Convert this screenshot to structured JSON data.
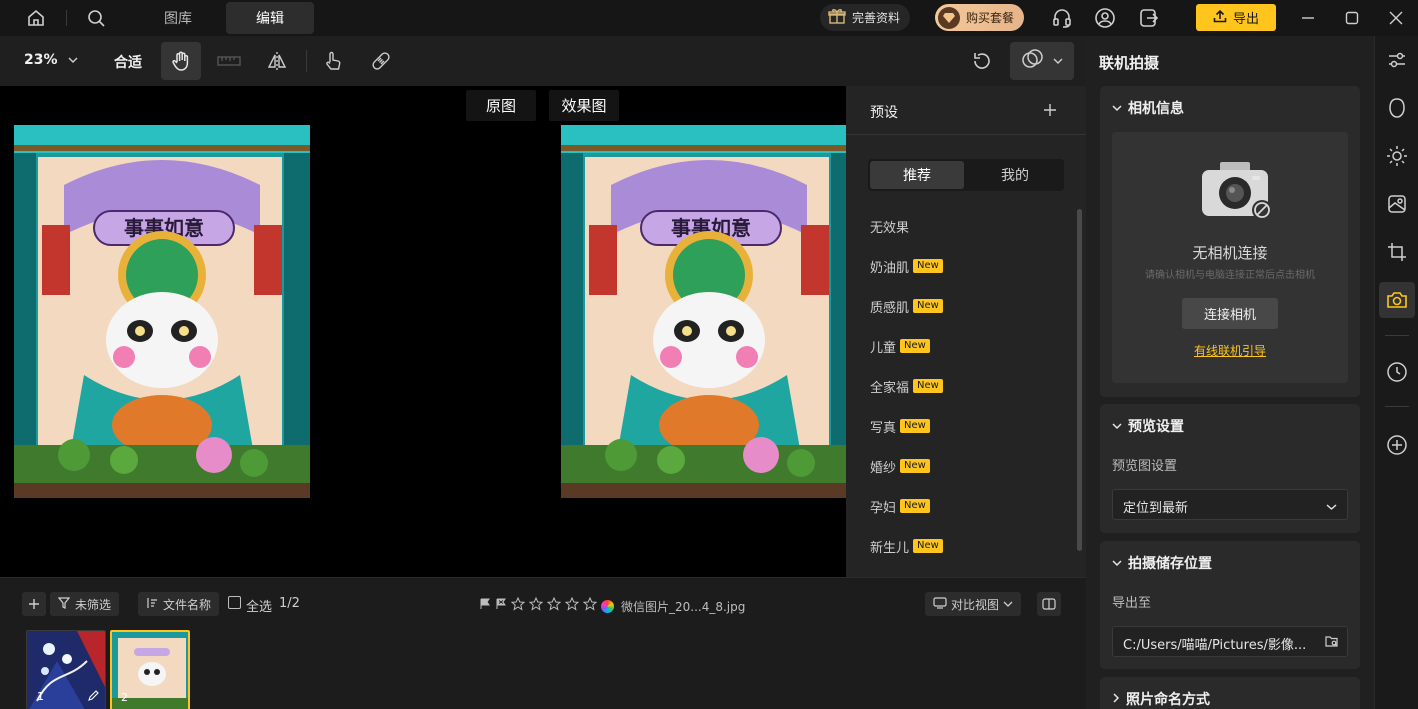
{
  "titlebar": {
    "tabs": [
      {
        "label": "图库",
        "active": false
      },
      {
        "label": "编辑",
        "active": true
      }
    ],
    "complete_profile": "完善资料",
    "buy_plan": "购买套餐",
    "export": "导出"
  },
  "toolbar": {
    "zoom": "23%",
    "fit": "合适"
  },
  "canvas": {
    "original_label": "原图",
    "effect_label": "效果图",
    "poster_banner": "事事如意"
  },
  "presets": {
    "title": "预设",
    "tabs": [
      {
        "label": "推荐",
        "active": true
      },
      {
        "label": "我的",
        "active": false
      }
    ],
    "items": [
      {
        "label": "无效果",
        "badge": ""
      },
      {
        "label": "奶油肌",
        "badge": "New"
      },
      {
        "label": "质感肌",
        "badge": "New"
      },
      {
        "label": "儿童",
        "badge": "New"
      },
      {
        "label": "全家福",
        "badge": "New"
      },
      {
        "label": "写真",
        "badge": "New"
      },
      {
        "label": "婚纱",
        "badge": "New"
      },
      {
        "label": "孕妇",
        "badge": "New"
      },
      {
        "label": "新生儿",
        "badge": "New"
      }
    ]
  },
  "bottombar": {
    "filter": "未筛选",
    "sort": "文件名称",
    "select_all": "全选",
    "count": "1/2",
    "filename": "微信图片_20...4_8.jpg",
    "view_mode": "对比视图",
    "thumbs": [
      {
        "index": "1",
        "selected": false
      },
      {
        "index": "2",
        "selected": true
      }
    ]
  },
  "rightpanel": {
    "title": "联机拍摄",
    "camera_info": {
      "title": "相机信息",
      "status": "无相机连接",
      "hint": "请确认相机与电脑连接正常后点击相机",
      "connect": "连接相机",
      "guide": "有线联机引导"
    },
    "preview": {
      "title": "预览设置",
      "label": "预览图设置",
      "value": "定位到最新"
    },
    "storage": {
      "title": "拍摄储存位置",
      "label": "导出至",
      "path": "C:/Users/喵喵/Pictures/影像..."
    },
    "naming": {
      "title": "照片命名方式"
    }
  },
  "colors": {
    "accent": "#ffc51c",
    "background": "#000000",
    "panel": "#242424"
  }
}
